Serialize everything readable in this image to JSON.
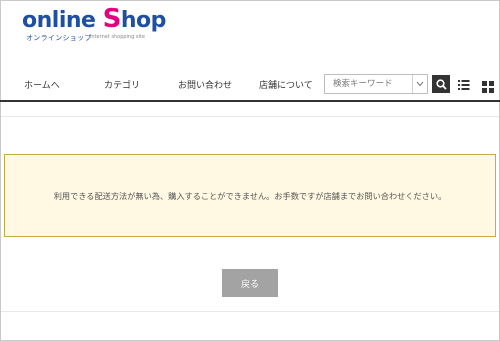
{
  "logo": {
    "main_prefix": "online ",
    "main_s": "S",
    "main_suffix": "hop",
    "kana": "オンラインショップ",
    "sub": "internet shopping site"
  },
  "nav": {
    "items": [
      "ホームへ",
      "カテゴリ",
      "お問い合わせ",
      "店舗について"
    ]
  },
  "search": {
    "placeholder": "検索キーワード"
  },
  "message": {
    "text": "利用できる配送方法が無い為、購入することができません。お手数ですが店舗までお問い合わせください。"
  },
  "back_button": {
    "label": "戻る"
  },
  "colors": {
    "brand_blue": "#1f4fa3",
    "brand_pink": "#e4007f",
    "notice_bg": "#fff9e3",
    "notice_border": "#c7a94a"
  },
  "icons": [
    "chevron-down-icon",
    "search-icon",
    "list-view-icon",
    "grid-view-icon"
  ]
}
